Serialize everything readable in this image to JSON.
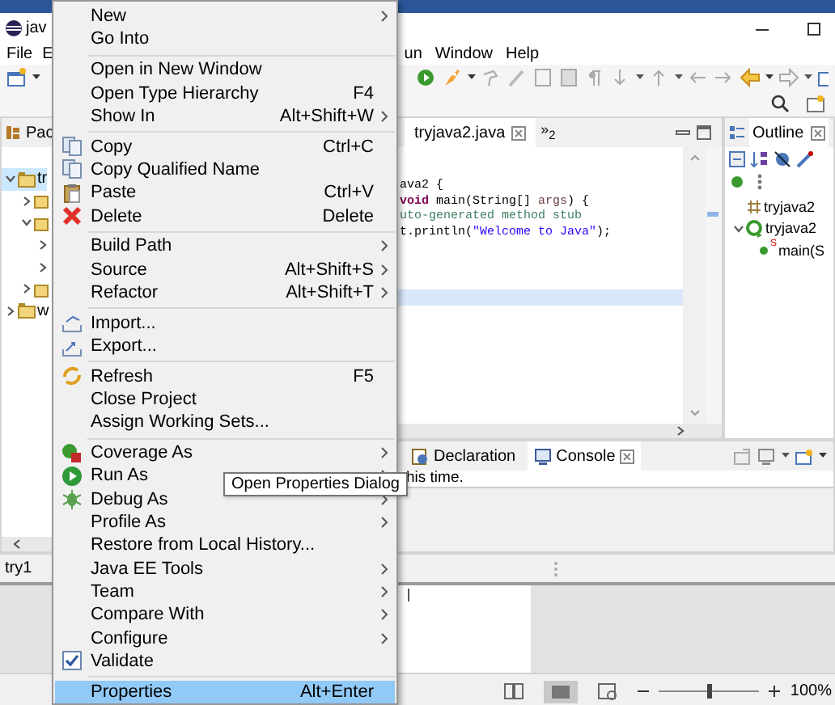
{
  "window": {
    "title": "jav",
    "menu_bar": [
      "File",
      "E",
      "un",
      "Window",
      "Help"
    ]
  },
  "package_explorer": {
    "tab": "Pac",
    "tree": [
      {
        "label": "tr",
        "expanded": true,
        "selected": true,
        "children": [
          {
            "expanded": false,
            "selected": false
          },
          {
            "expanded": true,
            "selected": false,
            "children": [
              {
                "expanded": false,
                "selected": false
              },
              {
                "expanded": false,
                "selected": false
              }
            ]
          },
          {
            "expanded": false,
            "selected": false
          }
        ]
      },
      {
        "label": "w",
        "expanded": false,
        "selected": false
      }
    ],
    "status": "try1"
  },
  "editor": {
    "tabs": [
      {
        "label": "tryjava2.java",
        "selected": true
      }
    ],
    "overflow": "»$_{2}$",
    "lines": [
      {
        "current": false,
        "segments": [
          {
            "kind": "plain",
            "text": "ava2 {"
          }
        ]
      },
      {
        "current": false,
        "segments": [
          {
            "kind": "keyword",
            "text": "void"
          },
          {
            "kind": "plain",
            "text": " main(String[] "
          },
          {
            "kind": "variable",
            "text": "args"
          },
          {
            "kind": "plain",
            "text": ") {"
          }
        ]
      },
      {
        "current": false,
        "segments": [
          {
            "kind": "comment",
            "text": "uto-generated method stub"
          }
        ]
      },
      {
        "current": false,
        "segments": [
          {
            "kind": "plain",
            "text": "t.println("
          },
          {
            "kind": "string",
            "text": "\"Welcome to Java\""
          },
          {
            "kind": "plain",
            "text": ");"
          }
        ]
      },
      {
        "current": false
      },
      {
        "current": false
      },
      {
        "current": false
      },
      {
        "current": true
      }
    ]
  },
  "outline": {
    "tab": "Outline",
    "tree": [
      {
        "label": "tryjava2",
        "kind": "imports"
      },
      {
        "label": "tryjava2",
        "kind": "class",
        "expanded": true,
        "children": [
          {
            "label": "main(S",
            "kind": "method",
            "modifier": "S"
          }
        ]
      }
    ]
  },
  "console": {
    "tabs": [
      {
        "label": "Declaration",
        "selected": false
      },
      {
        "label": "Console",
        "selected": true
      }
    ],
    "message": "his time."
  },
  "document_app": {
    "zoom": "100%",
    "zoom_slider": {
      "level": 0.5
    }
  },
  "context_menu": {
    "groups": [
      [
        {
          "label": "New",
          "submenu": true,
          "selected": false
        },
        {
          "label": "Go Into",
          "submenu": false,
          "selected": false
        }
      ],
      [
        {
          "label": "Open in New Window",
          "submenu": false,
          "selected": false
        },
        {
          "label": "Open Type Hierarchy",
          "shortcut": "F4",
          "submenu": false,
          "selected": false
        },
        {
          "label": "Show In",
          "shortcut": "Alt+Shift+W",
          "submenu": true,
          "selected": false
        }
      ],
      [
        {
          "label": "Copy",
          "shortcut": "Ctrl+C",
          "submenu": false,
          "selected": false
        },
        {
          "label": "Copy Qualified Name",
          "submenu": false,
          "selected": false
        },
        {
          "label": "Paste",
          "shortcut": "Ctrl+V",
          "submenu": false,
          "selected": false
        },
        {
          "label": "Delete",
          "shortcut": "Delete",
          "submenu": false,
          "selected": false
        }
      ],
      [
        {
          "label": "Build Path",
          "submenu": true,
          "selected": false
        },
        {
          "label": "Source",
          "shortcut": "Alt+Shift+S",
          "submenu": true,
          "selected": false
        },
        {
          "label": "Refactor",
          "shortcut": "Alt+Shift+T",
          "submenu": true,
          "selected": false
        }
      ],
      [
        {
          "label": "Import...",
          "submenu": false,
          "selected": false
        },
        {
          "label": "Export...",
          "submenu": false,
          "selected": false
        }
      ],
      [
        {
          "label": "Refresh",
          "shortcut": "F5",
          "submenu": false,
          "selected": false
        },
        {
          "label": "Close Project",
          "submenu": false,
          "selected": false
        },
        {
          "label": "Assign Working Sets...",
          "submenu": false,
          "selected": false
        }
      ],
      [
        {
          "label": "Coverage As",
          "submenu": true,
          "selected": false
        },
        {
          "label": "Run As",
          "submenu": true,
          "selected": false
        },
        {
          "label": "Debug As",
          "submenu": true,
          "selected": false
        },
        {
          "label": "Profile As",
          "submenu": true,
          "selected": false
        },
        {
          "label": "Restore from Local History...",
          "submenu": false,
          "selected": false
        },
        {
          "label": "Java EE Tools",
          "submenu": true,
          "selected": false
        },
        {
          "label": "Team",
          "submenu": true,
          "selected": false
        },
        {
          "label": "Compare With",
          "submenu": true,
          "selected": false
        },
        {
          "label": "Configure",
          "submenu": true,
          "selected": false
        },
        {
          "label": "Validate",
          "submenu": false,
          "selected": false
        }
      ],
      [
        {
          "label": "Properties",
          "shortcut": "Alt+Enter",
          "submenu": false,
          "selected": true
        }
      ]
    ]
  },
  "tooltip": {
    "text": "Open Properties Dialog"
  }
}
